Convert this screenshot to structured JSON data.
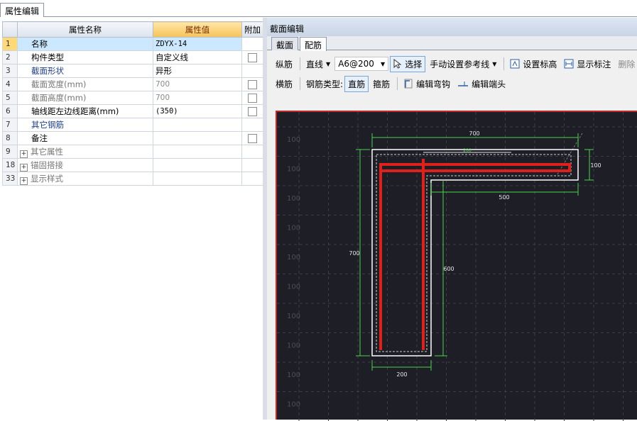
{
  "panel_tab": "属性编辑",
  "table": {
    "headers": [
      "属性名称",
      "属性值",
      "附加"
    ],
    "rows": [
      {
        "num": "1",
        "name": "名称",
        "value": "ZDYX-14",
        "check": false
      },
      {
        "num": "2",
        "name": "构件类型",
        "value": "自定义线",
        "check": true
      },
      {
        "num": "3",
        "name": "截面形状",
        "value": "异形",
        "check": false
      },
      {
        "num": "4",
        "name": "截面宽度(mm)",
        "value": "700",
        "check": true
      },
      {
        "num": "5",
        "name": "截面高度(mm)",
        "value": "700",
        "check": true
      },
      {
        "num": "6",
        "name": "轴线距左边线距离(mm)",
        "value": "(350)",
        "check": true
      },
      {
        "num": "7",
        "name": "其它钢筋",
        "value": "",
        "check": false
      },
      {
        "num": "8",
        "name": "备注",
        "value": "",
        "check": true
      },
      {
        "num": "9",
        "name": "其它属性",
        "value": "",
        "check": false
      },
      {
        "num": "18",
        "name": "锚固搭接",
        "value": "",
        "check": false
      },
      {
        "num": "33",
        "name": "显示样式",
        "value": "",
        "check": false
      }
    ]
  },
  "window": {
    "title": "截面编辑",
    "tabs": [
      "截面",
      "配筋"
    ],
    "toolbar1": {
      "rebar_dir": "纵筋",
      "line_mode": "直线",
      "spec": "A6@200",
      "select": "选择",
      "ref_line": "手动设置参考线",
      "set_elev": "设置标高",
      "show_dim": "显示标注",
      "delete": "删除"
    },
    "toolbar2": {
      "transverse": "横筋",
      "type_label": "钢筋类型:",
      "straight": "直筋",
      "stirrup": "箍筋",
      "edit_bend": "编辑弯钩",
      "edit_end": "编辑端头"
    }
  },
  "drawing": {
    "grid_label": "100",
    "dim_700_top": "700",
    "dim_100_right": "100",
    "dim_500": "500",
    "dim_700_left": "700",
    "dim_600": "600",
    "dim_200": "200",
    "dim_inner": "200",
    "colors": {
      "outline": "#ffffff",
      "rebar": "#e0201a",
      "dims": "#4cd44c",
      "grid": "#3a3f4a",
      "background": "#1e1e26"
    }
  }
}
